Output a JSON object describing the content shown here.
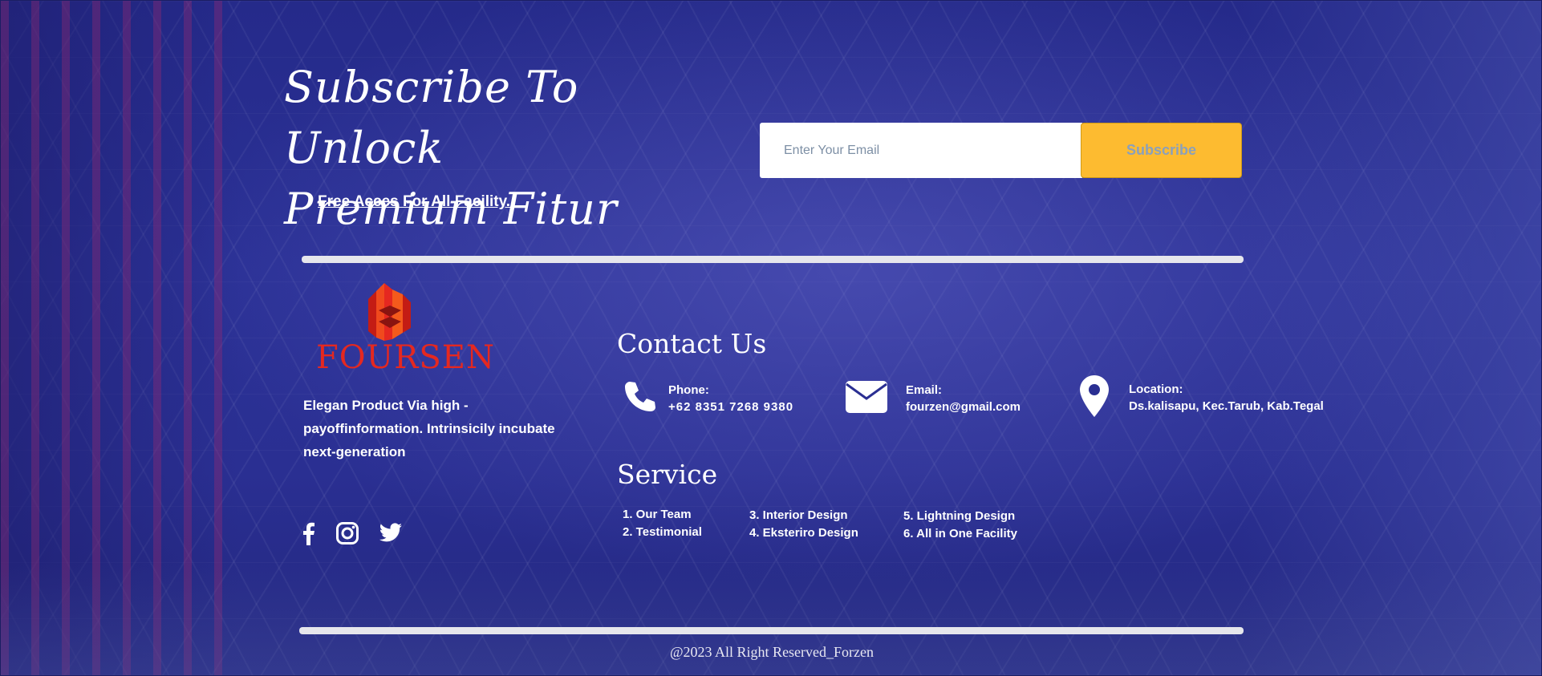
{
  "subscribe": {
    "title_line1": "Subscribe To Unlock",
    "title_line2": "Premium Fitur",
    "tagline": "Free Acces For All Facility.",
    "email_placeholder": "Enter Your Email",
    "button_label": "Subscribe"
  },
  "brand": {
    "name": "FOURSEN",
    "description": "Elegan Product Via high - payoffinformation. Intrinsicily incubate next-generation",
    "logo_colors": {
      "primary": "#e52820",
      "secondary": "#f45a1c"
    }
  },
  "social": [
    {
      "icon": "facebook-icon"
    },
    {
      "icon": "instagram-icon"
    },
    {
      "icon": "twitter-icon"
    }
  ],
  "contact": {
    "heading": "Contact Us",
    "items": [
      {
        "icon": "phone-icon",
        "label": "Phone:",
        "value": "+62 8351 7268 9380"
      },
      {
        "icon": "mail-icon",
        "label": "Email:",
        "value": "fourzen@gmail.com"
      },
      {
        "icon": "location-pin-icon",
        "label": "Location:",
        "value": "Ds.kalisapu, Kec.Tarub, Kab.Tegal"
      }
    ]
  },
  "service": {
    "heading": "Service",
    "columns": [
      [
        "1. Our Team",
        "2. Testimonial"
      ],
      [
        "3. Interior Design",
        "4. Eksteriro Design"
      ],
      [
        "5. Lightning Design",
        "6. All in One Facility"
      ]
    ]
  },
  "footer": {
    "copyright": "@2023 All Right Reserved_Forzen"
  },
  "colors": {
    "background": "#2a2f92",
    "accent_button": "#fdbb30",
    "divider": "#e6e6ec"
  }
}
